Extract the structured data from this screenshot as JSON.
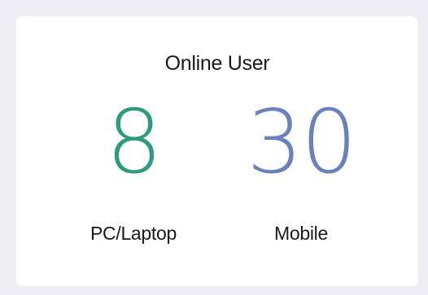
{
  "card": {
    "title": "Online User",
    "metrics": [
      {
        "value": "8",
        "label": "PC/Laptop",
        "color": "#2e9b7e"
      },
      {
        "value": "30",
        "label": "Mobile",
        "color": "#6a82bb"
      }
    ]
  },
  "colors": {
    "background": "#eeeef4",
    "card": "#ffffff",
    "text": "#1a1a1a"
  }
}
